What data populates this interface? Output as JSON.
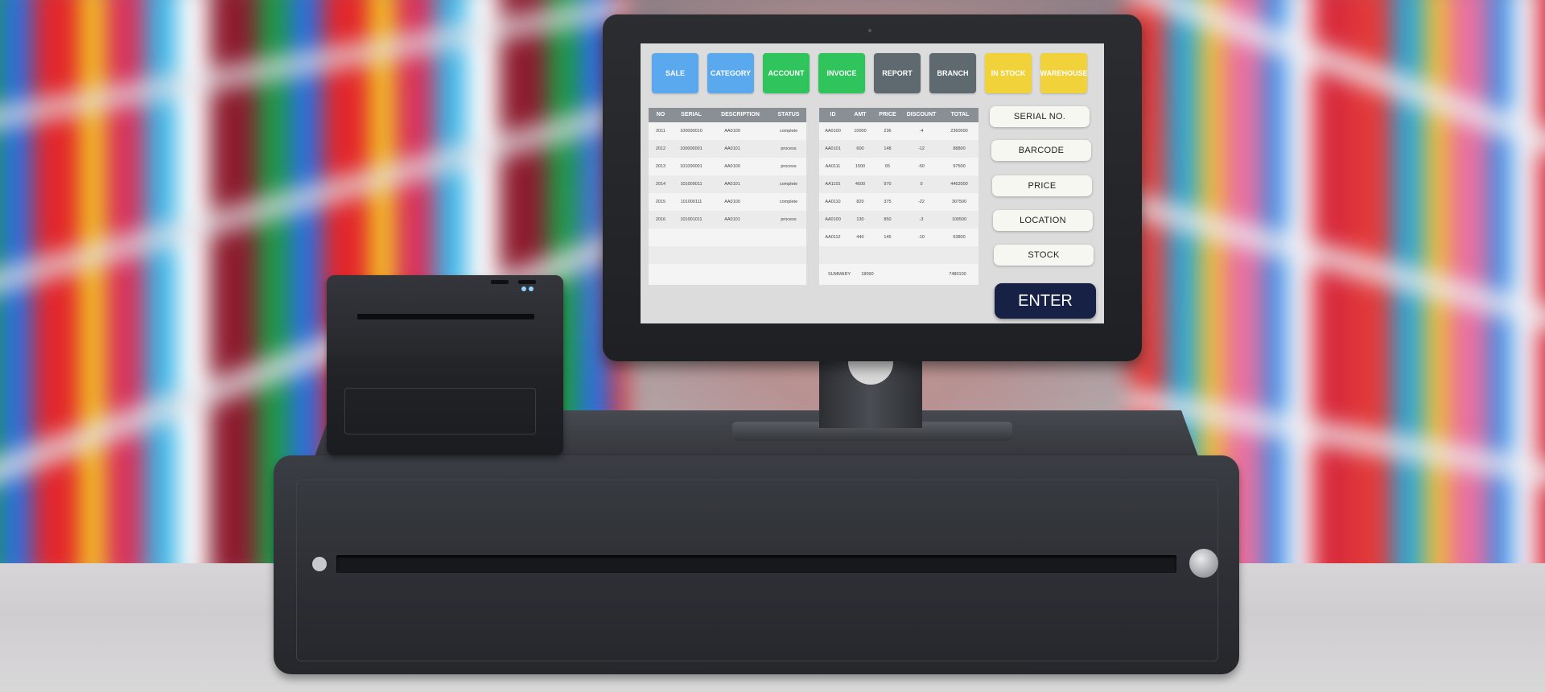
{
  "tabs": [
    {
      "label": "SALE",
      "color": "#5aa9ee"
    },
    {
      "label": "CATEGORY",
      "color": "#5aa9ee"
    },
    {
      "label": "ACCOUNT",
      "color": "#2fc45c"
    },
    {
      "label": "INVOICE",
      "color": "#2fc45c"
    },
    {
      "label": "REPORT",
      "color": "#5e6a70"
    },
    {
      "label": "BRANCH",
      "color": "#5e6a70"
    },
    {
      "label": "IN STOCK",
      "color": "#f2d23a"
    },
    {
      "label": "WAREHOUSE",
      "color": "#f2d23a"
    }
  ],
  "left_table": {
    "headers": [
      "NO",
      "SERIAL",
      "DESCRIPTION",
      "STATUS"
    ],
    "rows": [
      [
        "2011",
        "100000010",
        "AA0100",
        "complete"
      ],
      [
        "2012",
        "100000001",
        "AA0101",
        "process"
      ],
      [
        "2013",
        "101000001",
        "AA0100",
        "process"
      ],
      [
        "2014",
        "101000011",
        "AA0101",
        "complete"
      ],
      [
        "2015",
        "101000111",
        "AA0100",
        "complete"
      ],
      [
        "2016",
        "101001011",
        "AA0101",
        "process"
      ]
    ]
  },
  "right_table": {
    "headers": [
      "ID",
      "AMT",
      "PRICE",
      "DISCOUNT",
      "TOTAL"
    ],
    "rows": [
      [
        "AA0100",
        "10000",
        "236",
        "-4",
        "2360000"
      ],
      [
        "AA0101",
        "600",
        "148",
        "-12",
        "88800"
      ],
      [
        "AA0111",
        "1500",
        "65",
        "-50",
        "97500"
      ],
      [
        "AA1101",
        "4600",
        "970",
        "0",
        "4462000"
      ],
      [
        "AA0110",
        "820",
        "375",
        "-22",
        "307500"
      ],
      [
        "AA0100",
        "130",
        "850",
        "-3",
        "100500"
      ],
      [
        "AA0112",
        "440",
        "145",
        "-10",
        "63800"
      ]
    ],
    "summary": {
      "label": "SUMMARY",
      "amt": "18090",
      "total": "7480100"
    }
  },
  "side_buttons": [
    "SERIAL NO.",
    "BARCODE",
    "PRICE",
    "LOCATION",
    "STOCK"
  ],
  "enter_label": "ENTER"
}
